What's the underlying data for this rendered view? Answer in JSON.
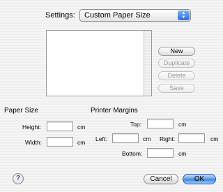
{
  "settings": {
    "label": "Settings:",
    "selected": "Custom Paper Size"
  },
  "buttons": {
    "new": "New",
    "duplicate": "Duplicate",
    "delete": "Delete",
    "save": "Save"
  },
  "paper_size": {
    "heading": "Paper Size",
    "height_label": "Height:",
    "height_value": "",
    "width_label": "Width:",
    "width_value": "",
    "unit": "cm"
  },
  "margins": {
    "heading": "Printer Margins",
    "top_label": "Top:",
    "left_label": "Left:",
    "right_label": "Right:",
    "bottom_label": "Bottom:",
    "top_value": "",
    "left_value": "",
    "right_value": "",
    "bottom_value": "",
    "unit": "cm"
  },
  "footer": {
    "help": "?",
    "cancel": "Cancel",
    "ok": "OK"
  },
  "colors": {
    "accent": "#3d83e0"
  }
}
